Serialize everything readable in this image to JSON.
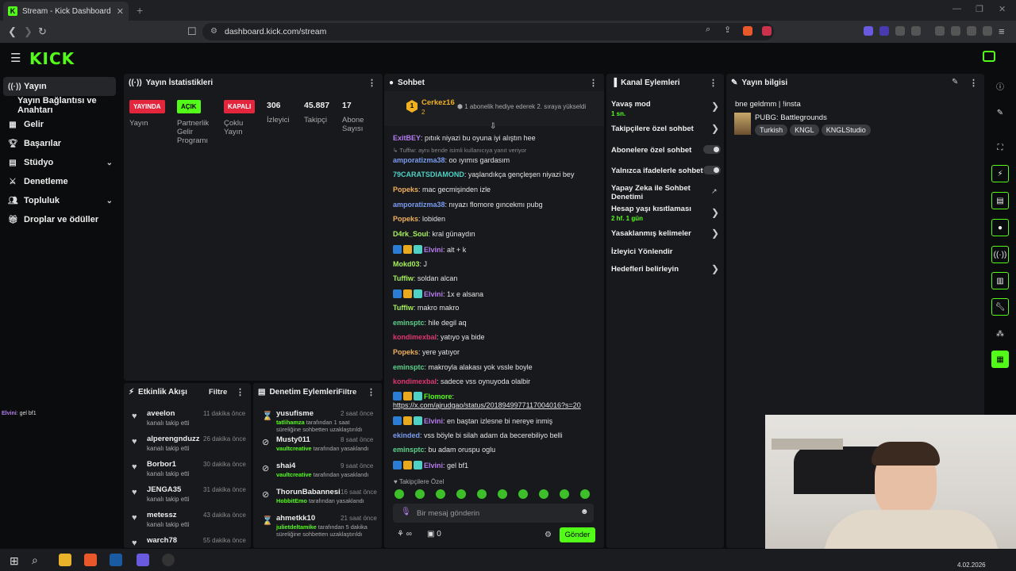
{
  "browser": {
    "tab_title": "Stream - Kick Dashboard",
    "url": "dashboard.kick.com/stream",
    "new_tab": "+",
    "close": "✕"
  },
  "header": {
    "logo": "KICK"
  },
  "sidebar": {
    "items": [
      {
        "label": "Yayın",
        "icon": "broadcast-icon"
      },
      {
        "label": "Yayın Bağlantısı ve Anahtarı"
      },
      {
        "label": "Gelir",
        "icon": "revenue-icon"
      },
      {
        "label": "Başarılar",
        "icon": "trophy-icon"
      },
      {
        "label": "Stüdyo",
        "icon": "studio-icon"
      },
      {
        "label": "Denetleme",
        "icon": "sword-icon"
      },
      {
        "label": "Topluluk",
        "icon": "users-icon"
      },
      {
        "label": "Droplar ve ödüller",
        "icon": "gift-icon"
      }
    ]
  },
  "stats": {
    "title": "Yayın İstatistikleri",
    "badges": [
      {
        "text": "YAYINDA",
        "label": "Yayın"
      },
      {
        "text": "AÇIK",
        "label": "Partnerlik Gelir Programı"
      },
      {
        "text": "KAPALI",
        "label": "Çoklu Yayın"
      }
    ],
    "numbers": [
      {
        "value": "306",
        "label": "İzleyici"
      },
      {
        "value": "45.887",
        "label": "Takipçi"
      },
      {
        "value": "17",
        "label": "Abone Sayısı"
      }
    ]
  },
  "chat": {
    "title": "Sohbet",
    "pinned_user": "Cerkez16",
    "pinned_rank": "2",
    "pinned_msg": "1 abonelik hediye ederek 2. sıraya yükseldi",
    "messages": [
      {
        "user": "ExitBEY",
        "text": "pıtıık niyazi bu oyuna iyi alıştın hee",
        "color": "#b57cf0"
      },
      {
        "user": "",
        "text": "↳ Tuffiw: aynı bende isimli kullanıcıya yanıt veriyor",
        "color": "#888"
      },
      {
        "user": "amporatizma38",
        "text": "oo ıyımıs gardasım",
        "color": "#7a9cf0"
      },
      {
        "user": "79CARATSDIAMOND",
        "text": "yaşlandıkça gençleşen niyazi bey",
        "color": "#4fd1c5"
      },
      {
        "user": "Popeks",
        "text": "mac gecmişinden izle",
        "color": "#f0b05a"
      },
      {
        "user": "amporatizma38",
        "text": "nıyazı flomore gıncekmı pubg",
        "color": "#7a9cf0"
      },
      {
        "user": "Popeks",
        "text": "lobiden",
        "color": "#f0b05a"
      },
      {
        "user": "D4rk_Soul",
        "text": "kral günaydın",
        "color": "#a6f05a"
      },
      {
        "user": "Elvini",
        "text": "alt + k",
        "color": "#b57cf0"
      },
      {
        "user": "Mokd03",
        "text": "J",
        "color": "#a6f05a"
      },
      {
        "user": "Tuffiw",
        "text": "soldan alcan",
        "color": "#a6f05a"
      },
      {
        "user": "Elvini",
        "text": "1x e alsana",
        "color": "#b57cf0"
      },
      {
        "user": "Tuffiw",
        "text": "makro makro",
        "color": "#a6f05a"
      },
      {
        "user": "eminsptc",
        "text": "hile degil aq",
        "color": "#5ad18a"
      },
      {
        "user": "kondimexbal",
        "text": "yatıyo ya bide",
        "color": "#e0356e"
      },
      {
        "user": "Popeks",
        "text": "yere yatıyor",
        "color": "#f0b05a"
      },
      {
        "user": "eminsptc",
        "text": "makroyla alakası yok vssle boyle",
        "color": "#5ad18a"
      },
      {
        "user": "kondimexbal",
        "text": "sadece vss oynuyoda olalbir",
        "color": "#e0356e"
      },
      {
        "user": "Flomore",
        "text": "",
        "color": "#53fc18"
      },
      {
        "user": "",
        "text": "https://x.com/ajrudgao/status/2018949977117004016?s=20",
        "color": "#e4e4e4"
      },
      {
        "user": "Elvini",
        "text": "en baştan izlesne bi nereye inmiş",
        "color": "#b57cf0"
      },
      {
        "user": "ekinded",
        "text": "vss böyle bi silah adam da becerebiliyo belli",
        "color": "#7a9cf0"
      },
      {
        "user": "eminsptc",
        "text": "bu adam oruspu oglu",
        "color": "#5ad18a"
      },
      {
        "user": "Elvini",
        "text": "gel bf1",
        "color": "#b57cf0"
      }
    ],
    "followers_only": "Takipçilere Özel",
    "input_placeholder": "Bir mesaj gönderin",
    "count_infinity": "∞",
    "count_zero": "0",
    "send_label": "Gönder"
  },
  "channel_actions": {
    "title": "Kanal Eylemleri",
    "items": [
      {
        "label": "Yavaş mod",
        "sub": "1 sn."
      },
      {
        "label": "Takipçilere özel sohbet"
      },
      {
        "label": "Abonelere özel sohbet"
      },
      {
        "label": "Yalnızca ifadelerle sohbet"
      },
      {
        "label": "Yapay Zeka ile Sohbet Denetimi"
      },
      {
        "label": "Hesap yaşı kısıtlaması",
        "sub": "2 hf. 1 gün"
      },
      {
        "label": "Yasaklanmış kelimeler"
      },
      {
        "label": "İzleyici Yönlendir"
      },
      {
        "label": "Hedefleri belirleyin"
      }
    ]
  },
  "stream_info": {
    "title": "Yayın bilgisi",
    "stream_title": "bne geldmm | !insta",
    "category": "PUBG: Battlegrounds",
    "tags": [
      "Turkish",
      "KNGL",
      "KNGLStudio"
    ]
  },
  "activity": {
    "title": "Etkinlik Akışı",
    "filter": "Filtre",
    "items": [
      {
        "name": "aveelon",
        "sub": "kanalı takip etti",
        "time": "11 dakika önce"
      },
      {
        "name": "alperengnduzz",
        "sub": "kanalı takip etti",
        "time": "26 dakika önce"
      },
      {
        "name": "Borbor1",
        "sub": "kanalı takip etti",
        "time": "30 dakika önce"
      },
      {
        "name": "JENGA35",
        "sub": "kanalı takip etti",
        "time": "31 dakika önce"
      },
      {
        "name": "metessz",
        "sub": "kanalı takip etti",
        "time": "43 dakika önce"
      },
      {
        "name": "warch78",
        "sub": "",
        "time": "55 dakika önce"
      }
    ]
  },
  "moderation": {
    "title": "Denetim Eylemleri",
    "filter": "Filtre",
    "items": [
      {
        "name": "yusufisme",
        "mod": "tatlihamza",
        "sub": "tarafından 1 saat süreliğine sohbetten uzaklaştırıldı",
        "time": "2 saat önce"
      },
      {
        "name": "Musty011",
        "mod": "vaultcreative",
        "sub": "tarafından yasaklandı",
        "time": "8 saat önce"
      },
      {
        "name": "shai4",
        "mod": "vaultcreative",
        "sub": "tarafından yasaklandı",
        "time": "9 saat önce"
      },
      {
        "name": "ThorunBabannesi",
        "mod": "HobbitEmo",
        "sub": "tarafından yasaklandı",
        "time": "16 saat önce"
      },
      {
        "name": "ahmetkk10",
        "mod": "julietdeltamike",
        "sub": "tarafından 5 dakika süreliğine sohbetten uzaklaştırıldı",
        "time": "21 saat önce"
      }
    ]
  },
  "overlay_chat": {
    "user": "Elvini",
    "text": "gel bf1"
  },
  "taskbar": {
    "date": "4.02.2026"
  }
}
